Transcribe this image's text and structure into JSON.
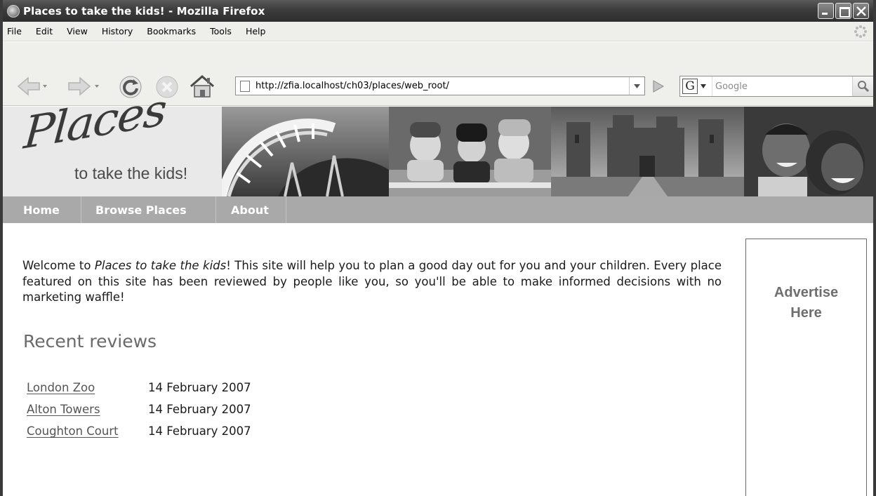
{
  "window": {
    "title": "Places to take the kids! - Mozilla Firefox"
  },
  "menubar": {
    "items": [
      {
        "label": "File",
        "accel": "F"
      },
      {
        "label": "Edit",
        "accel": "E"
      },
      {
        "label": "View",
        "accel": "V"
      },
      {
        "label": "History",
        "accel": "s"
      },
      {
        "label": "Bookmarks",
        "accel": "B"
      },
      {
        "label": "Tools",
        "accel": "T"
      },
      {
        "label": "Help",
        "accel": "H"
      }
    ]
  },
  "navbar": {
    "url": "http://zfia.localhost/ch03/places/web_root/",
    "search_placeholder": "Google",
    "search_engine_icon": "G"
  },
  "site": {
    "logo_script": "Places",
    "logo_sub": "to take the kids!",
    "nav": [
      {
        "label": "Home"
      },
      {
        "label": "Browse Places"
      },
      {
        "label": "About"
      }
    ],
    "intro_prefix": "Welcome to ",
    "intro_em": "Places to take the kids",
    "intro_suffix": "! This site will help you to plan a good day out for you and your children. Every place featured on this site has been reviewed by people like you, so you'll be able to make informed decisions with no marketing waffle!",
    "section_title": "Recent reviews",
    "reviews": [
      {
        "name": "London Zoo",
        "date": "14 February 2007"
      },
      {
        "name": "Alton Towers",
        "date": "14 February 2007"
      },
      {
        "name": "Coughton Court",
        "date": "14 February 2007"
      }
    ],
    "ad_line1": "Advertise",
    "ad_line2": "Here"
  }
}
